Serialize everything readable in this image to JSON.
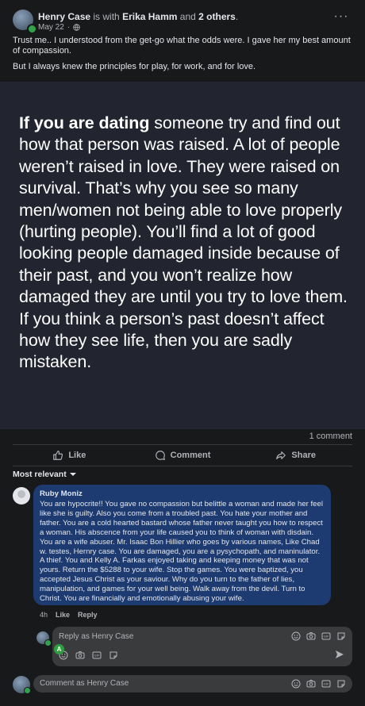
{
  "post": {
    "author": "Henry Case",
    "with_text": "is with",
    "tagged": "Erika Hamm",
    "and_text": "and",
    "others": "2 others",
    "date": "May 22",
    "privacy_icon": "globe-icon",
    "caption_1": "Trust me.. I understood from the get-go what the odds were. I gave her my best amount of compassion.",
    "caption_2": "But I always knew the principles for play, for work, and for love."
  },
  "quote": {
    "bold_lead": "If you are dating",
    "body": " someone try and find out how that person was raised. A lot of people weren’t raised in love. They were raised on survival.  That’s why you see so many men/women not being able to love properly (hurting people). You’ll find a lot of good looking people damaged inside because of their past, and you won’t realize how damaged they are until you try to love them.  If you think a person’s past doesn’t affect how they see life, then you are sadly mistaken."
  },
  "stats": {
    "comment_count": "1 comment"
  },
  "actions": {
    "like": "Like",
    "comment": "Comment",
    "share": "Share"
  },
  "sort": {
    "label": "Most relevant"
  },
  "comment": {
    "name": "Ruby Moniz",
    "text": "You are hypocrite!! You gave no compassion but belittle a woman and made her feel like she is guilty. Also you come from a troubled past. You hate your mother and father. You are a cold hearted bastard whose father never taught you how to respect a woman. His abscence from your life caused you to think of woman with disdain. You are a wife abuser. Mr. Isaac Bon Hillier who goes by various names, Like Chad w. testes, Hernry case. You are damaged, you are a pysychopath, and maninulator. A thief. You and Kelly A. Farkas enjoyed taking and keeping money that was not yours. Return the $5288 to your wife. Stop the games. You were baptized, you accepted Jesus Christ as your saviour. Why do you turn to the father of lies, manipulation, and games for your well being. Walk away from the devil. Turn to Christ. You are financially and emotionally abusing your wife.",
    "time": "4h",
    "like": "Like",
    "reply": "Reply"
  },
  "reply_box": {
    "placeholder": "Reply as Henry Case",
    "badge": "A"
  },
  "comment_box": {
    "placeholder": "Comment as Henry Case"
  },
  "colors": {
    "background": "#18191a",
    "bubble": "#1d3b70",
    "online": "#31a24c",
    "text": "#e4e6eb",
    "muted": "#b0b3b8"
  }
}
